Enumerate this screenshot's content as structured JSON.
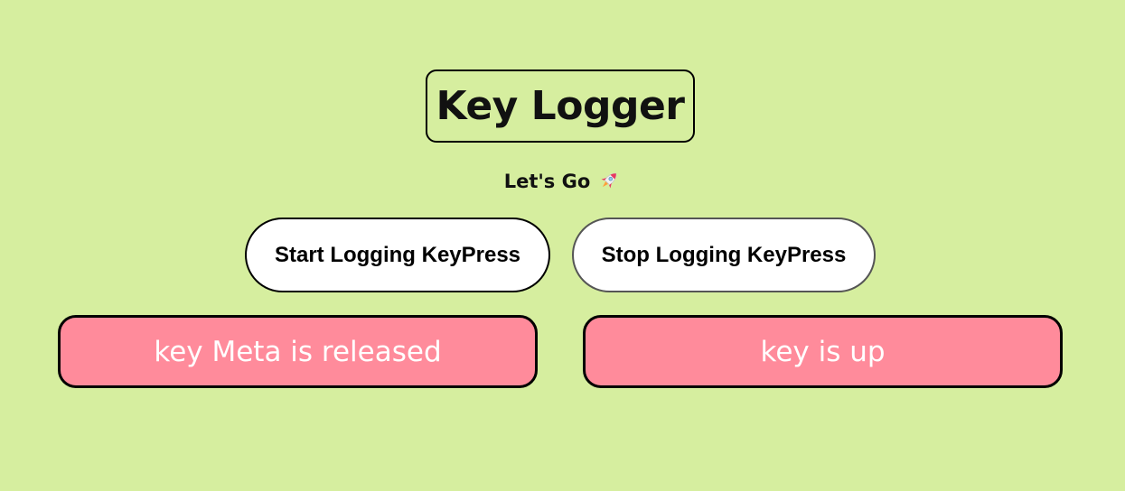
{
  "header": {
    "title": "Key Logger",
    "subtitle": "Let's Go",
    "subtitle_icon": "rocket-icon"
  },
  "controls": {
    "start_label": "Start Logging KeyPress",
    "stop_label": "Stop Logging KeyPress"
  },
  "status": {
    "key_event": "key Meta is released",
    "key_state": "key is up"
  },
  "colors": {
    "background": "#d6ee9f",
    "card": "#ff8b9b",
    "button": "#ffffff"
  }
}
